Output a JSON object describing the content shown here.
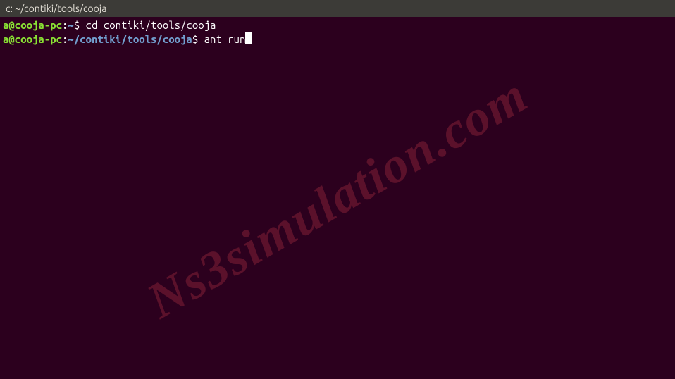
{
  "titlebar": {
    "title": "c: ~/contiki/tools/cooja"
  },
  "terminal": {
    "lines": [
      {
        "user": "a@cooja-pc",
        "colon": ":",
        "path": "~",
        "dollar": "$ ",
        "command": "cd contiki/tools/cooja"
      },
      {
        "user": "a@cooja-pc",
        "colon": ":",
        "path": "~/contiki/tools/cooja",
        "dollar": "$ ",
        "command": "ant run"
      }
    ]
  },
  "watermark": {
    "text": "Ns3simulation.com"
  }
}
